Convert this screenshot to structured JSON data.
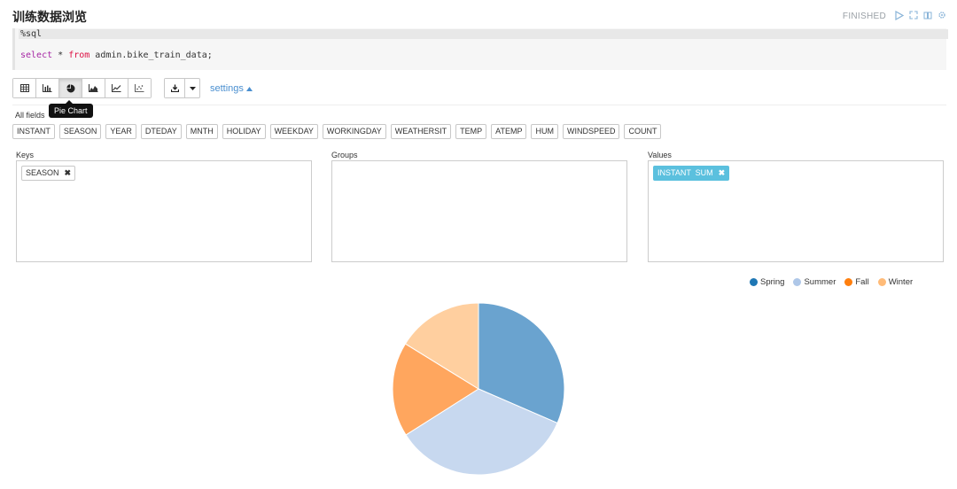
{
  "paragraph": {
    "title": "训练数据浏览",
    "status": "FINISHED"
  },
  "editor": {
    "line1": "%sql",
    "line3_kw": "select",
    "line3_star": " * ",
    "line3_from": "from",
    "line3_table": " admin.bike_train_data;"
  },
  "toolbar": {
    "buttons": [
      "table-icon",
      "bar-chart-icon",
      "pie-chart-icon",
      "area-chart-icon",
      "line-chart-icon",
      "scatter-chart-icon"
    ],
    "active": "pie-chart-icon",
    "settings_label": "settings",
    "tooltip": "Pie Chart"
  },
  "pivot": {
    "all_fields_label": "All fields",
    "fields": [
      "INSTANT",
      "SEASON",
      "YEAR",
      "DTEDAY",
      "MNTH",
      "HOLIDAY",
      "WEEKDAY",
      "WORKINGDAY",
      "WEATHERSIT",
      "TEMP",
      "ATEMP",
      "HUM",
      "WINDSPEED",
      "COUNT"
    ],
    "keys_label": "Keys",
    "groups_label": "Groups",
    "values_label": "Values",
    "key_chip": "SEASON",
    "value_chip": "INSTANT  SUM"
  },
  "chart_data": {
    "type": "pie",
    "categories": [
      "Spring",
      "Summer",
      "Fall",
      "Winter"
    ],
    "values": [
      31.5,
      34.5,
      17.8,
      16.2
    ],
    "colors": [
      "#1f77b4",
      "#aec7e8",
      "#ff7f0e",
      "#ffbb78"
    ],
    "title": "",
    "legend_position": "top-right"
  }
}
